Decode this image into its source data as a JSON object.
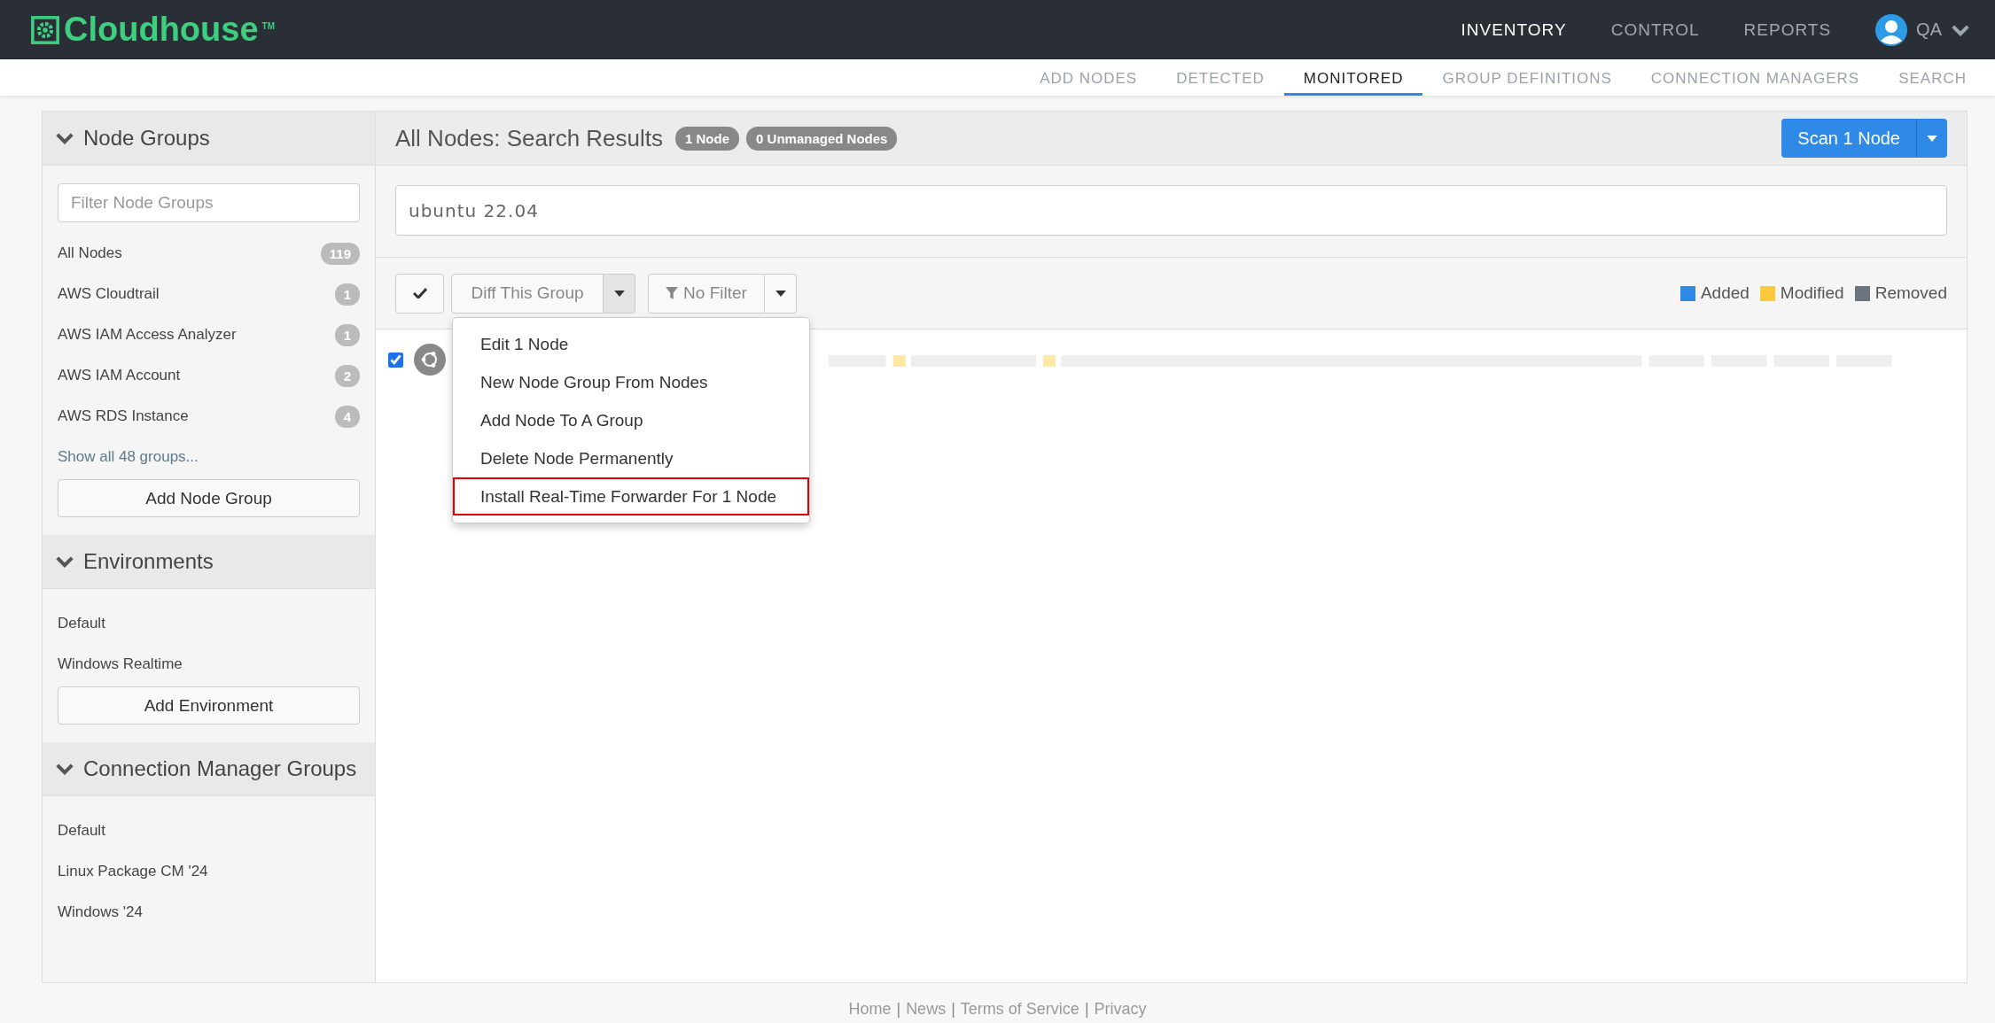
{
  "header": {
    "logo": "Cloudhouse",
    "trademark": "TM",
    "nav": [
      {
        "label": "INVENTORY",
        "selected": true
      },
      {
        "label": "CONTROL",
        "selected": false
      },
      {
        "label": "REPORTS",
        "selected": false
      }
    ],
    "user": "QA"
  },
  "subnav": [
    {
      "label": "ADD NODES",
      "selected": false
    },
    {
      "label": "DETECTED",
      "selected": false
    },
    {
      "label": "MONITORED",
      "selected": true
    },
    {
      "label": "GROUP DEFINITIONS",
      "selected": false
    },
    {
      "label": "CONNECTION MANAGERS",
      "selected": false
    },
    {
      "label": "SEARCH",
      "selected": false
    }
  ],
  "sidebar": {
    "sections": [
      {
        "title": "Node Groups",
        "filter_placeholder": "Filter Node Groups",
        "items": [
          {
            "label": "All Nodes",
            "count": "119"
          },
          {
            "label": "AWS Cloudtrail",
            "count": "1"
          },
          {
            "label": "AWS IAM Access Analyzer",
            "count": "1"
          },
          {
            "label": "AWS IAM Account",
            "count": "2"
          },
          {
            "label": "AWS RDS Instance",
            "count": "4"
          }
        ],
        "more_link": "Show all 48 groups...",
        "button": "Add Node Group"
      },
      {
        "title": "Environments",
        "items": [
          {
            "label": "Default"
          },
          {
            "label": "Windows Realtime"
          }
        ],
        "button": "Add Environment"
      },
      {
        "title": "Connection Manager Groups",
        "items": [
          {
            "label": "Default"
          },
          {
            "label": "Linux Package CM '24"
          },
          {
            "label": "Windows '24"
          }
        ]
      }
    ]
  },
  "main": {
    "title": "All Nodes: Search Results",
    "badges": [
      "1 Node",
      "0 Unmanaged Nodes"
    ],
    "scan_button": "Scan 1 Node",
    "search_value": "ubuntu 22.04",
    "toolbar": {
      "diff_button": "Diff This Group",
      "filter_button": "No Filter"
    },
    "legend": [
      {
        "label": "Added",
        "color": "#2e8ae6"
      },
      {
        "label": "Modified",
        "color": "#ffc83d"
      },
      {
        "label": "Removed",
        "color": "#6c757d"
      }
    ],
    "row": {
      "checked": true
    },
    "menu": [
      {
        "label": "Edit 1 Node",
        "outlined": false
      },
      {
        "label": "New Node Group From Nodes",
        "outlined": false
      },
      {
        "label": "Add Node To A Group",
        "outlined": false
      },
      {
        "label": "Delete Node Permanently",
        "outlined": false
      },
      {
        "label": "Install Real-Time Forwarder For 1 Node",
        "outlined": true
      }
    ]
  },
  "footer": {
    "links": [
      "Home",
      "News",
      "Terms of Service",
      "Privacy"
    ],
    "separator": "|"
  }
}
